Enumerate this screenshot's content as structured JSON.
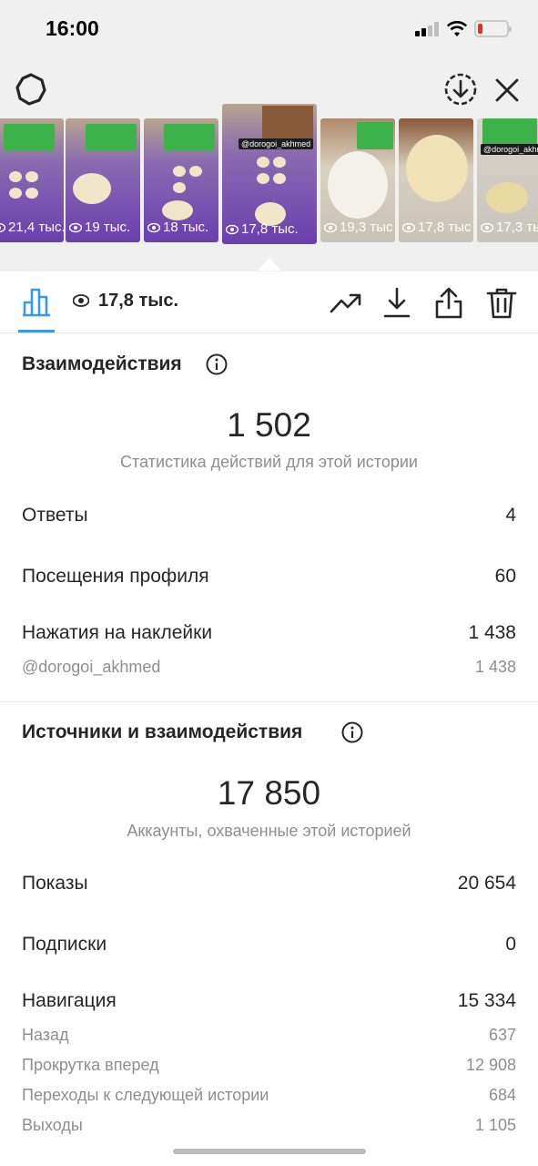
{
  "status_bar": {
    "time": "16:00"
  },
  "thumbnails": [
    {
      "views": "21,4 тыс."
    },
    {
      "views": "19 тыс."
    },
    {
      "views": "18 тыс."
    },
    {
      "views": "17,8 тыс.",
      "handle": "@dorogoi_akhmed",
      "selected": true
    },
    {
      "views": "19,3 тыс"
    },
    {
      "views": "17,8 тыс"
    },
    {
      "views": "17,3 тыс",
      "handle": "@dorogoi_akhmed"
    }
  ],
  "toolbar": {
    "views": "17,8 тыс."
  },
  "interactions": {
    "title": "Взаимодействия",
    "total": "1 502",
    "subtitle": "Статистика действий для этой истории",
    "rows": [
      {
        "label": "Ответы",
        "value": "4"
      },
      {
        "label": "Посещения профиля",
        "value": "60"
      },
      {
        "label": "Нажатия на наклейки",
        "value": "1 438"
      }
    ],
    "sticker": {
      "label": "@dorogoi_akhmed",
      "value": "1 438"
    }
  },
  "discovery": {
    "title": "Источники и взаимодействия",
    "total": "17 850",
    "subtitle": "Аккаунты, охваченные этой историей",
    "rows": [
      {
        "label": "Показы",
        "value": "20 654"
      },
      {
        "label": "Подписки",
        "value": "0"
      },
      {
        "label": "Навигация",
        "value": "15 334"
      }
    ],
    "navigation": [
      {
        "label": "Назад",
        "value": "637"
      },
      {
        "label": "Прокрутка вперед",
        "value": "12 908"
      },
      {
        "label": "Переходы к следующей истории",
        "value": "684"
      },
      {
        "label": "Выходы",
        "value": "1 105"
      }
    ]
  }
}
